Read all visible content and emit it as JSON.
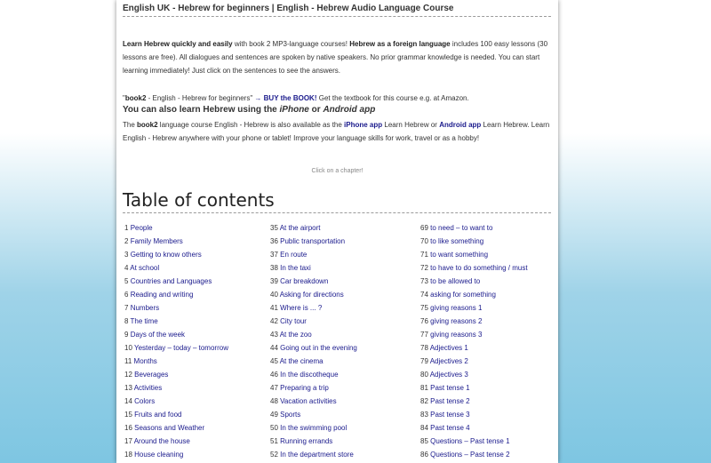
{
  "header": {
    "title": "English UK - Hebrew for beginners | English - Hebrew Audio Language Course"
  },
  "intro": {
    "bold1": "Learn Hebrew quickly and easily",
    "text1": " with book 2 MP3-language courses! ",
    "bold2": "Hebrew as a foreign language",
    "text2": " includes 100 easy lessons (30 lessons are free). All dialogues and sentences are spoken by native speakers. No prior grammar knowledge is needed. You can start learning immediately! Just click on the sentences to see the answers."
  },
  "book": {
    "q_open": "\"",
    "bold": "book2",
    "text": " - English - Hebrew for beginners\" ",
    "link": "→ BUY the BOOK!",
    "text2": " Get the textbook for this course e.g. at Amazon."
  },
  "also_learn": {
    "prefix": "You can also learn Hebrew using the ",
    "iphone": "iPhone",
    "or": " or ",
    "android": "Android app"
  },
  "apps": {
    "text1": "The ",
    "bold": "book2",
    "text2": " language course English - Hebrew is also available as the ",
    "iphone_link": "iPhone app",
    "text3": " Learn Hebrew or ",
    "android_link": "Android app",
    "text4": " Learn Hebrew. Learn English - Hebrew anywhere with your phone or tablet! Improve your language skills for work, travel or as a hobby!"
  },
  "hint": "Click on a chapter!",
  "toc": {
    "title": "Table of contents",
    "columns": [
      [
        {
          "num": "1",
          "label": "People"
        },
        {
          "num": "2",
          "label": "Family Members"
        },
        {
          "num": "3",
          "label": "Getting to know others"
        },
        {
          "num": "4",
          "label": "At school"
        },
        {
          "num": "5",
          "label": "Countries and Languages"
        },
        {
          "num": "6",
          "label": "Reading and writing"
        },
        {
          "num": "7",
          "label": "Numbers"
        },
        {
          "num": "8",
          "label": "The time"
        },
        {
          "num": "9",
          "label": "Days of the week"
        },
        {
          "num": "10",
          "label": "Yesterday – today – tomorrow"
        },
        {
          "num": "11",
          "label": "Months"
        },
        {
          "num": "12",
          "label": "Beverages"
        },
        {
          "num": "13",
          "label": "Activities"
        },
        {
          "num": "14",
          "label": "Colors"
        },
        {
          "num": "15",
          "label": "Fruits and food"
        },
        {
          "num": "16",
          "label": "Seasons and Weather"
        },
        {
          "num": "17",
          "label": "Around the house"
        },
        {
          "num": "18",
          "label": "House cleaning"
        }
      ],
      [
        {
          "num": "35",
          "label": "At the airport"
        },
        {
          "num": "36",
          "label": "Public transportation"
        },
        {
          "num": "37",
          "label": "En route"
        },
        {
          "num": "38",
          "label": "In the taxi"
        },
        {
          "num": "39",
          "label": "Car breakdown"
        },
        {
          "num": "40",
          "label": "Asking for directions"
        },
        {
          "num": "41",
          "label": "Where is ... ?"
        },
        {
          "num": "42",
          "label": "City tour"
        },
        {
          "num": "43",
          "label": "At the zoo"
        },
        {
          "num": "44",
          "label": "Going out in the evening"
        },
        {
          "num": "45",
          "label": "At the cinema"
        },
        {
          "num": "46",
          "label": "In the discotheque"
        },
        {
          "num": "47",
          "label": "Preparing a trip"
        },
        {
          "num": "48",
          "label": "Vacation activities"
        },
        {
          "num": "49",
          "label": "Sports"
        },
        {
          "num": "50",
          "label": "In the swimming pool"
        },
        {
          "num": "51",
          "label": "Running errands"
        },
        {
          "num": "52",
          "label": "In the department store"
        }
      ],
      [
        {
          "num": "69",
          "label": "to need – to want to"
        },
        {
          "num": "70",
          "label": "to like something"
        },
        {
          "num": "71",
          "label": "to want something"
        },
        {
          "num": "72",
          "label": "to have to do something / must"
        },
        {
          "num": "73",
          "label": "to be allowed to"
        },
        {
          "num": "74",
          "label": "asking for something"
        },
        {
          "num": "75",
          "label": "giving reasons 1"
        },
        {
          "num": "76",
          "label": "giving reasons 2"
        },
        {
          "num": "77",
          "label": "giving reasons 3"
        },
        {
          "num": "78",
          "label": "Adjectives 1"
        },
        {
          "num": "79",
          "label": "Adjectives 2"
        },
        {
          "num": "80",
          "label": "Adjectives 3"
        },
        {
          "num": "81",
          "label": "Past tense 1"
        },
        {
          "num": "82",
          "label": "Past tense 2"
        },
        {
          "num": "83",
          "label": "Past tense 3"
        },
        {
          "num": "84",
          "label": "Past tense 4"
        },
        {
          "num": "85",
          "label": "Questions – Past tense 1"
        },
        {
          "num": "86",
          "label": "Questions – Past tense 2"
        }
      ]
    ]
  },
  "colors": {
    "link": "#1a1a8c",
    "text": "#333333",
    "bg_top": "#ffffff",
    "bg_bottom": "#7ec6e2"
  }
}
